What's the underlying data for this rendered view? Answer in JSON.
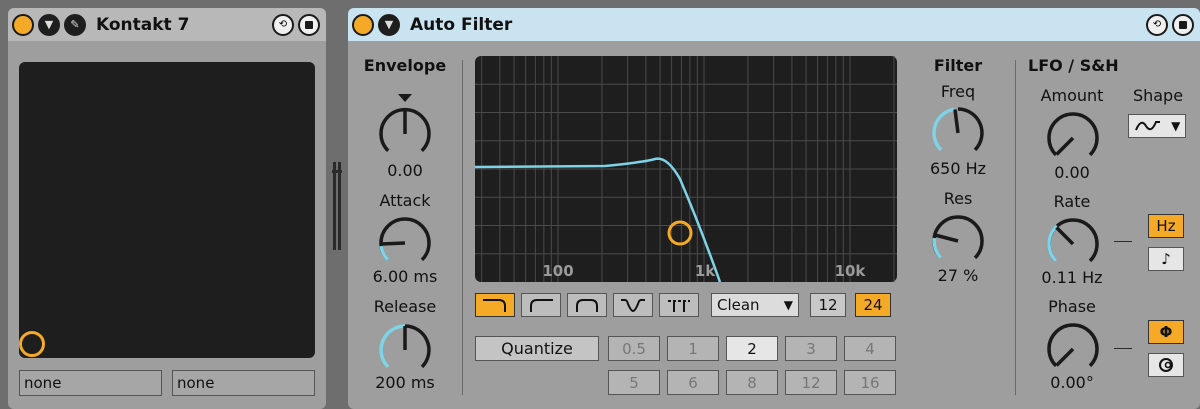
{
  "kontakt": {
    "title": "Kontakt 7",
    "param_left": "none",
    "param_right": "none"
  },
  "auto_filter": {
    "title": "Auto Filter",
    "envelope": {
      "heading": "Envelope",
      "amount_value": "0.00",
      "attack_label": "Attack",
      "attack_value": "6.00 ms",
      "release_label": "Release",
      "release_value": "200 ms"
    },
    "graph": {
      "freq_labels": [
        "100",
        "1k",
        "10k"
      ]
    },
    "filter_types": [
      "lowpass",
      "highpass",
      "bandpass",
      "notch",
      "morph"
    ],
    "selected_filter_type": "lowpass",
    "circuit": {
      "value": "Clean",
      "arrow": "▼"
    },
    "slope": {
      "options": [
        "12",
        "24"
      ],
      "selected": "24"
    },
    "quantize": {
      "label": "Quantize",
      "values": [
        "0.5",
        "1",
        "2",
        "3",
        "4",
        "5",
        "6",
        "8",
        "12",
        "16"
      ],
      "selected": "2"
    },
    "filter": {
      "heading": "Filter",
      "freq_label": "Freq",
      "freq_value": "650 Hz",
      "res_label": "Res",
      "res_value": "27 %"
    },
    "lfo": {
      "heading": "LFO / S&H",
      "amount_label": "Amount",
      "amount_value": "0.00",
      "shape_label": "Shape",
      "shape_arrow": "▼",
      "rate_label": "Rate",
      "rate_value": "0.11 Hz",
      "hz_label": "Hz",
      "sync_glyph": "♪",
      "phase_label": "Phase",
      "phase_value": "0.00°",
      "phi_glyph": "Φ",
      "spin_glyph": "⊘"
    }
  },
  "colors": {
    "accent": "#f5aa27",
    "curve": "#7fd3e6",
    "panel": "#9e9e9e",
    "graph_bg": "#1e1e1e"
  }
}
